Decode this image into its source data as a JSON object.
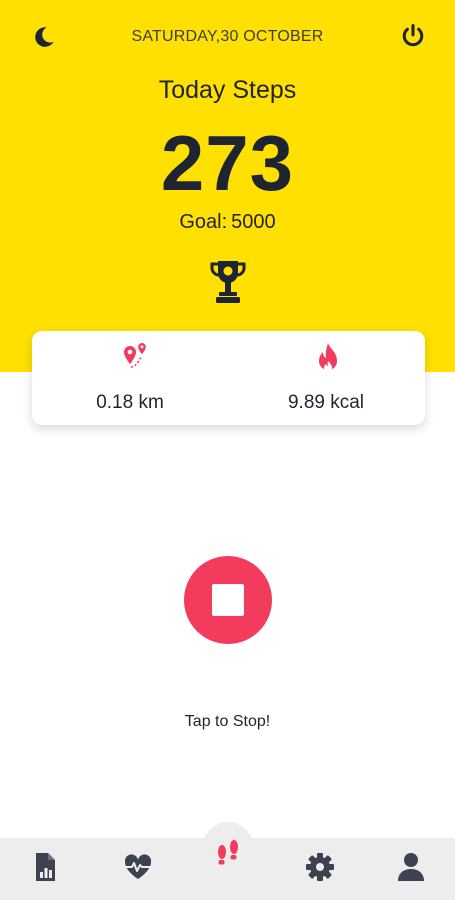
{
  "header": {
    "date": "SATURDAY,30 OCTOBER",
    "title": "Today Steps",
    "steps": "273",
    "goal_label": "Goal:",
    "goal_value": "5000"
  },
  "stats": {
    "distance": "0.18 km",
    "calories": "9.89 kcal"
  },
  "action": {
    "tap_label": "Tap to Stop!"
  },
  "icons": {
    "theme": "moon-icon",
    "power": "power-icon",
    "trophy": "trophy-icon",
    "distance": "map-pin-route-icon",
    "calories": "flame-icon",
    "nav": [
      "report-icon",
      "heartbeat-icon",
      "footsteps-icon",
      "gear-icon",
      "user-icon"
    ]
  },
  "colors": {
    "header_bg": "#FFE000",
    "accent": "#F33B5D",
    "nav_bg": "#EDEDED",
    "nav_icon": "#3d4251",
    "text": "#1f2433"
  },
  "nav": {
    "active": "footsteps"
  }
}
